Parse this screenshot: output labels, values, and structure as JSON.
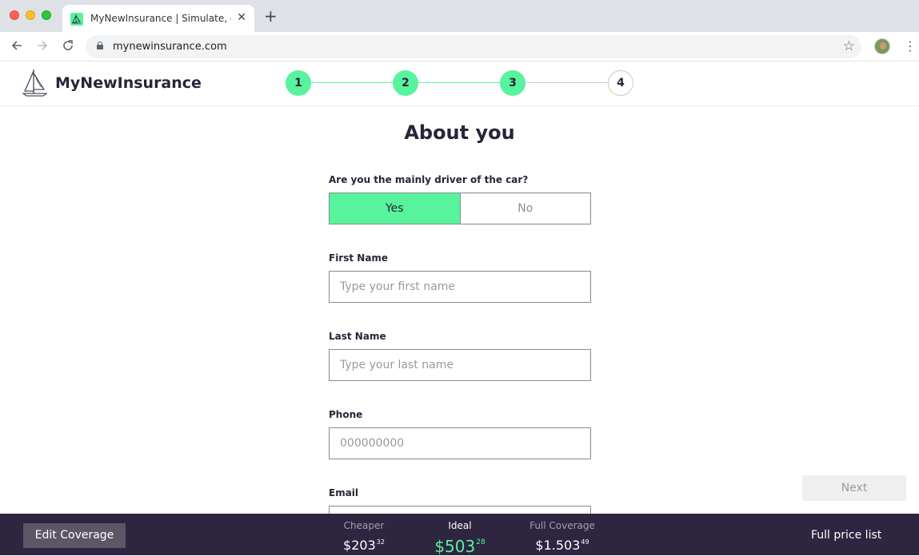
{
  "browser": {
    "tab_title": "MyNewInsurance | Simulate, com",
    "tab_close": "✕",
    "new_tab": "+",
    "url": "mynewinsurance.com"
  },
  "header": {
    "brand": "MyNewInsurance",
    "steps": [
      "1",
      "2",
      "3",
      "4"
    ],
    "current_step": 3,
    "accent_color": "#57f39d"
  },
  "form": {
    "title": "About you",
    "driver_question": "Are you the mainly driver of the car?",
    "driver_options": [
      "Yes",
      "No"
    ],
    "driver_selected": "Yes",
    "first_name_label": "First Name",
    "first_name_placeholder": "Type your first name",
    "last_name_label": "Last Name",
    "last_name_placeholder": "Type your last name",
    "phone_label": "Phone",
    "phone_placeholder": "000000000",
    "email_label": "Email",
    "next_label": "Next"
  },
  "footer": {
    "edit_label": "Edit Coverage",
    "plans": [
      {
        "name": "Cheaper",
        "price_main": "$203",
        "price_cents": "32"
      },
      {
        "name": "Ideal",
        "price_main": "$503",
        "price_cents": "28"
      },
      {
        "name": "Full Coverage",
        "price_main": "$1.503",
        "price_cents": "49"
      }
    ],
    "price_list_label": "Full price list",
    "bar_color": "#2e2540"
  }
}
